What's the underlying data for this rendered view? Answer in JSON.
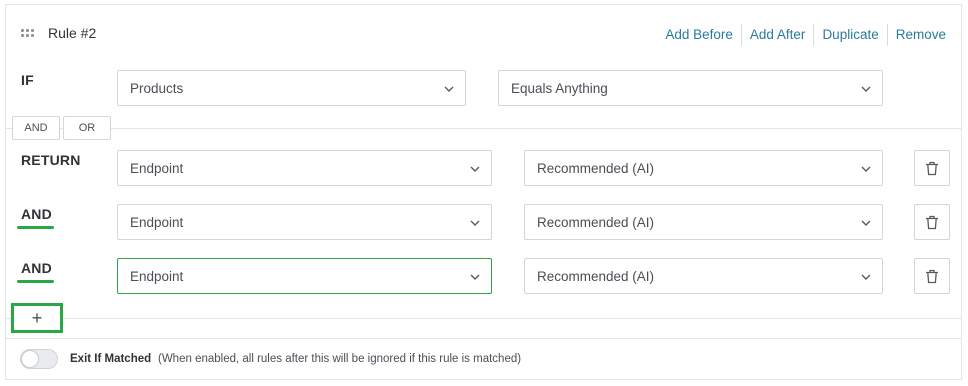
{
  "rule": {
    "title": "Rule #2",
    "actions": [
      "Add Before",
      "Add After",
      "Duplicate",
      "Remove"
    ]
  },
  "condition": {
    "keyword": "IF",
    "field": "Products",
    "operator": "Equals Anything"
  },
  "logic_toggle": {
    "and_label": "AND",
    "or_label": "OR"
  },
  "returns": [
    {
      "keyword": "RETURN",
      "field": "Endpoint",
      "value": "Recommended (AI)"
    },
    {
      "keyword": "AND",
      "field": "Endpoint",
      "value": "Recommended (AI)"
    },
    {
      "keyword": "AND",
      "field": "Endpoint",
      "value": "Recommended (AI)"
    }
  ],
  "add_button": {
    "label": "+"
  },
  "exit_if_matched": {
    "label": "Exit If Matched",
    "note": "(When enabled, all rules after this will be ignored if this rule is matched)",
    "enabled": false
  },
  "colors": {
    "link": "#2b7b9e",
    "highlight": "#27a844",
    "border": "#d3d7dc"
  },
  "icons": [
    "grip-icon",
    "chevron-down-icon",
    "trash-icon",
    "plus-icon"
  ]
}
